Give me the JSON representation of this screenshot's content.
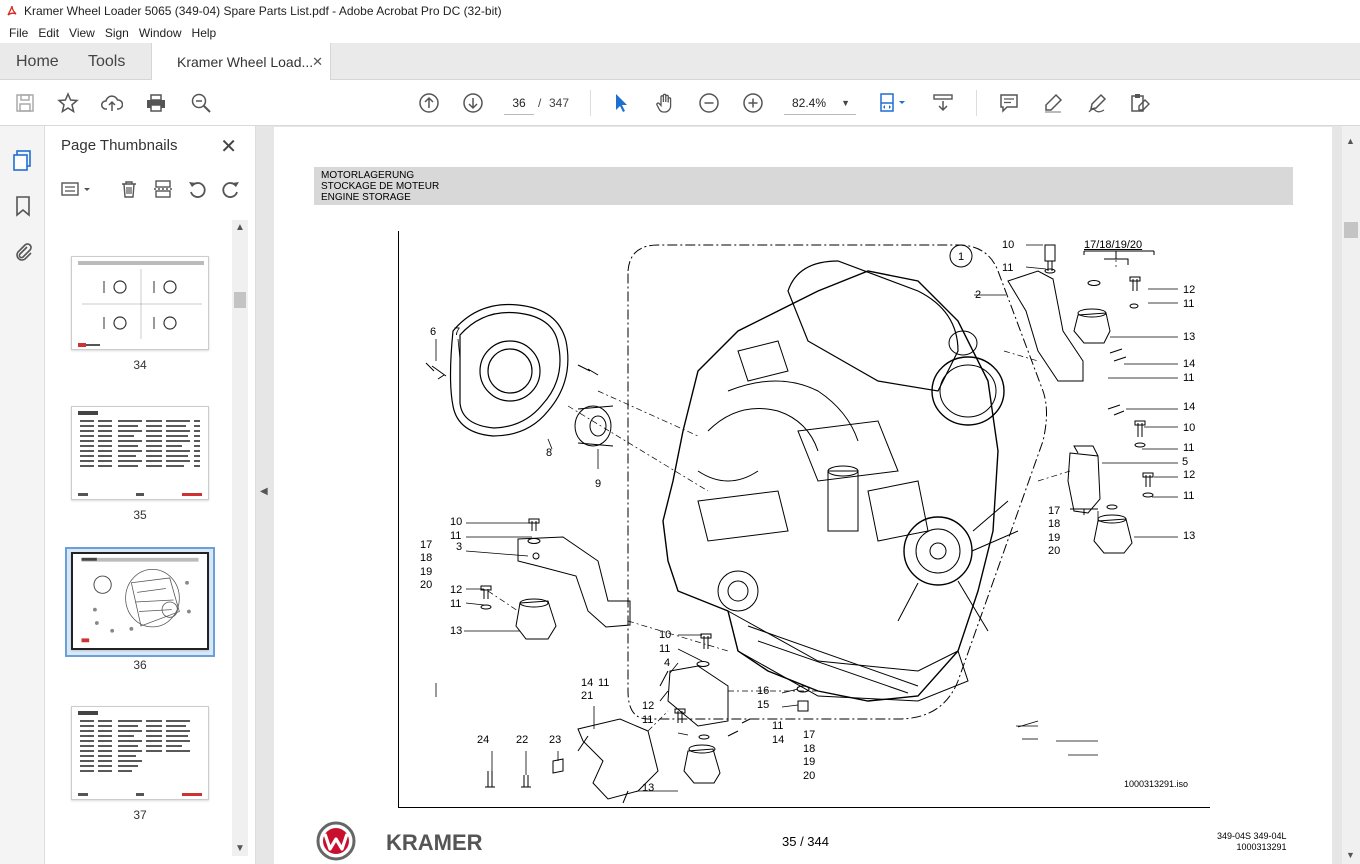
{
  "window": {
    "title": "Kramer Wheel Loader 5065 (349-04) Spare Parts List.pdf - Adobe Acrobat Pro DC (32-bit)"
  },
  "menu": [
    "File",
    "Edit",
    "View",
    "Sign",
    "Window",
    "Help"
  ],
  "tabs": {
    "home": "Home",
    "tools": "Tools",
    "document": "Kramer Wheel Load...",
    "close_glyph": "✕"
  },
  "toolbar": {
    "current_page": "36",
    "page_separator": "/",
    "total_pages": "347",
    "zoom": "82.4%"
  },
  "thumbnails_panel": {
    "title": "Page Thumbnails",
    "close_glyph": "✕",
    "pages": [
      "34",
      "35",
      "36",
      "37"
    ],
    "selected_page": "36"
  },
  "page": {
    "header_lines": [
      "MOTORLAGERUNG",
      "STOCKAGE DE MOTEUR",
      "ENGINE STORAGE"
    ],
    "iso_reference": "1000313291.iso",
    "footer_page": "35 / 344",
    "footer_model": "349-04S   349-04L",
    "footer_doc": "1000313291",
    "brand": "KRAMER",
    "callouts": {
      "c1": "1",
      "c2": "2",
      "c3": "3",
      "c4": "4",
      "c5": "5",
      "c6": "6",
      "c7": "7",
      "c8": "8",
      "c9": "9",
      "c10a": "10",
      "c11a": "11",
      "group_top": "17/18/19/20",
      "c12a": "12",
      "c11b": "11",
      "c13a": "13",
      "c14a": "14",
      "c11c": "11",
      "c14b": "14",
      "c10b": "10",
      "c11d": "11",
      "c12b": "12",
      "c11e": "11",
      "c17a": "17",
      "c18a": "18",
      "c19a": "19",
      "c20a": "20",
      "c13b": "13",
      "c10c": "10",
      "c11f": "11",
      "c17b": "17",
      "c18b": "18",
      "c19b": "19",
      "c20b": "20",
      "c12c": "12",
      "c11g": "11",
      "c13c": "13",
      "c10d": "10",
      "c11h": "11",
      "c14c": "14",
      "c11i": "11",
      "c21": "21",
      "c16": "16",
      "c15": "15",
      "c12d": "12",
      "c11j": "11",
      "c11k": "11",
      "c14d": "14",
      "c17c": "17",
      "c18c": "18",
      "c19c": "19",
      "c20c": "20",
      "c24": "24",
      "c22": "22",
      "c23": "23",
      "c13d": "13"
    }
  }
}
